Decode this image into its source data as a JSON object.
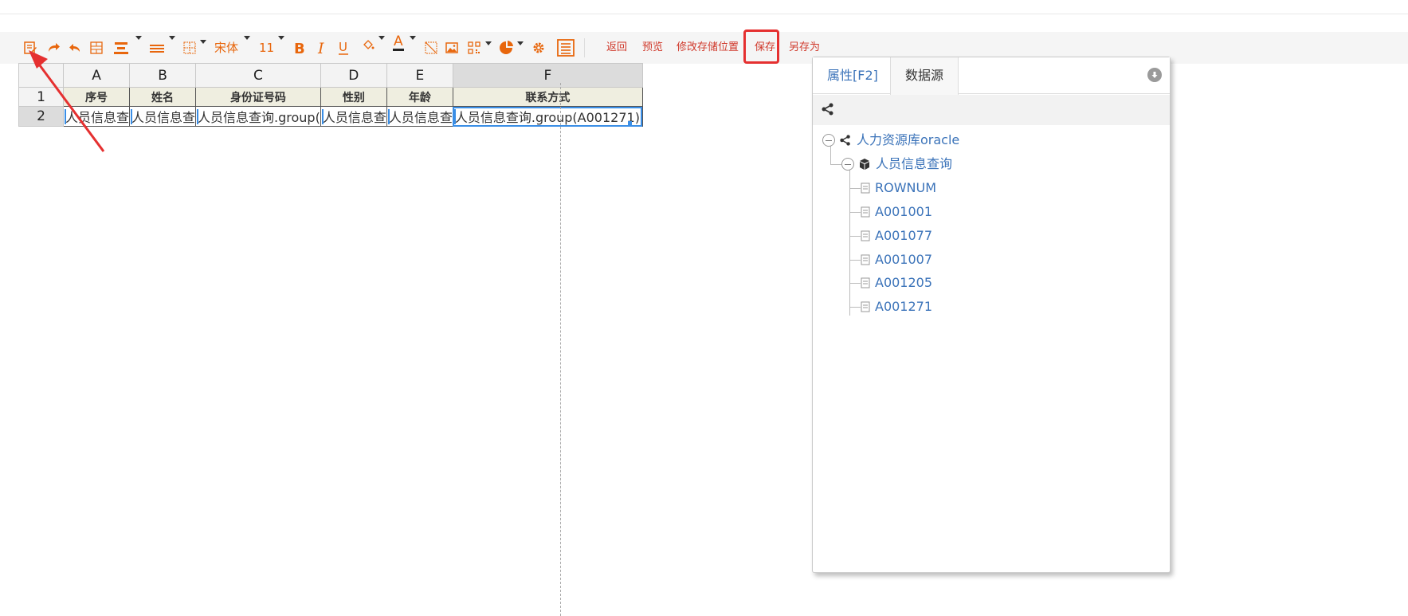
{
  "toolbar": {
    "font_name": "宋体",
    "font_size": "11",
    "actions": {
      "back": "返回",
      "preview": "预览",
      "change_storage": "修改存储位置",
      "save": "保存",
      "save_as": "另存为"
    }
  },
  "grid": {
    "columns": [
      "A",
      "B",
      "C",
      "D",
      "E",
      "F"
    ],
    "rows": [
      "1",
      "2"
    ],
    "header_row": [
      "序号",
      "姓名",
      "身份证号码",
      "性别",
      "年龄",
      "联系方式"
    ],
    "data_row": [
      "人员信息查",
      "人员信息查",
      "人员信息查询.group(",
      "人员信息查",
      "人员信息查",
      "人员信息查询.group(A001271)"
    ]
  },
  "panel": {
    "tabs": [
      "属性[F2]",
      "数据源"
    ],
    "active_tab": "数据源",
    "tree": {
      "datasource": "人力资源库oracle",
      "dataset": "人员信息查询",
      "fields": [
        "ROWNUM",
        "A001001",
        "A001077",
        "A001007",
        "A001205",
        "A001271"
      ]
    }
  },
  "colors": {
    "toolbar_icon": "#e8660c",
    "action_link": "#d0392b",
    "highlight_box": "#e53030",
    "tree_text": "#3b73b9",
    "selection": "#3a8ee6"
  }
}
